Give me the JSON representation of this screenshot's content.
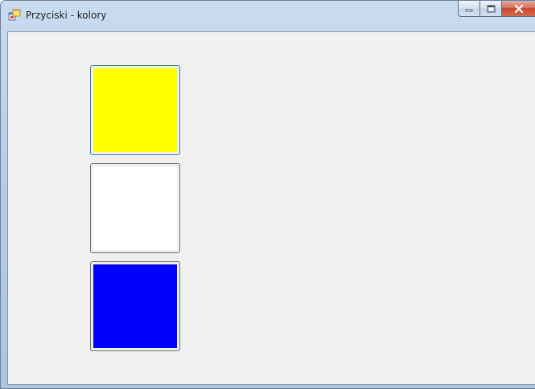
{
  "window": {
    "title": "Przyciski - kolory",
    "icon": "app-window-icon"
  },
  "caption_buttons": {
    "minimize_icon": "minimize-icon",
    "maximize_icon": "maximize-icon",
    "close_icon": "close-icon"
  },
  "buttons": [
    {
      "name": "color-button-yellow",
      "color": "#ffff00",
      "focused": true
    },
    {
      "name": "color-button-white",
      "color": "#ffffff",
      "focused": false
    },
    {
      "name": "color-button-blue",
      "color": "#0000ff",
      "focused": false
    }
  ]
}
